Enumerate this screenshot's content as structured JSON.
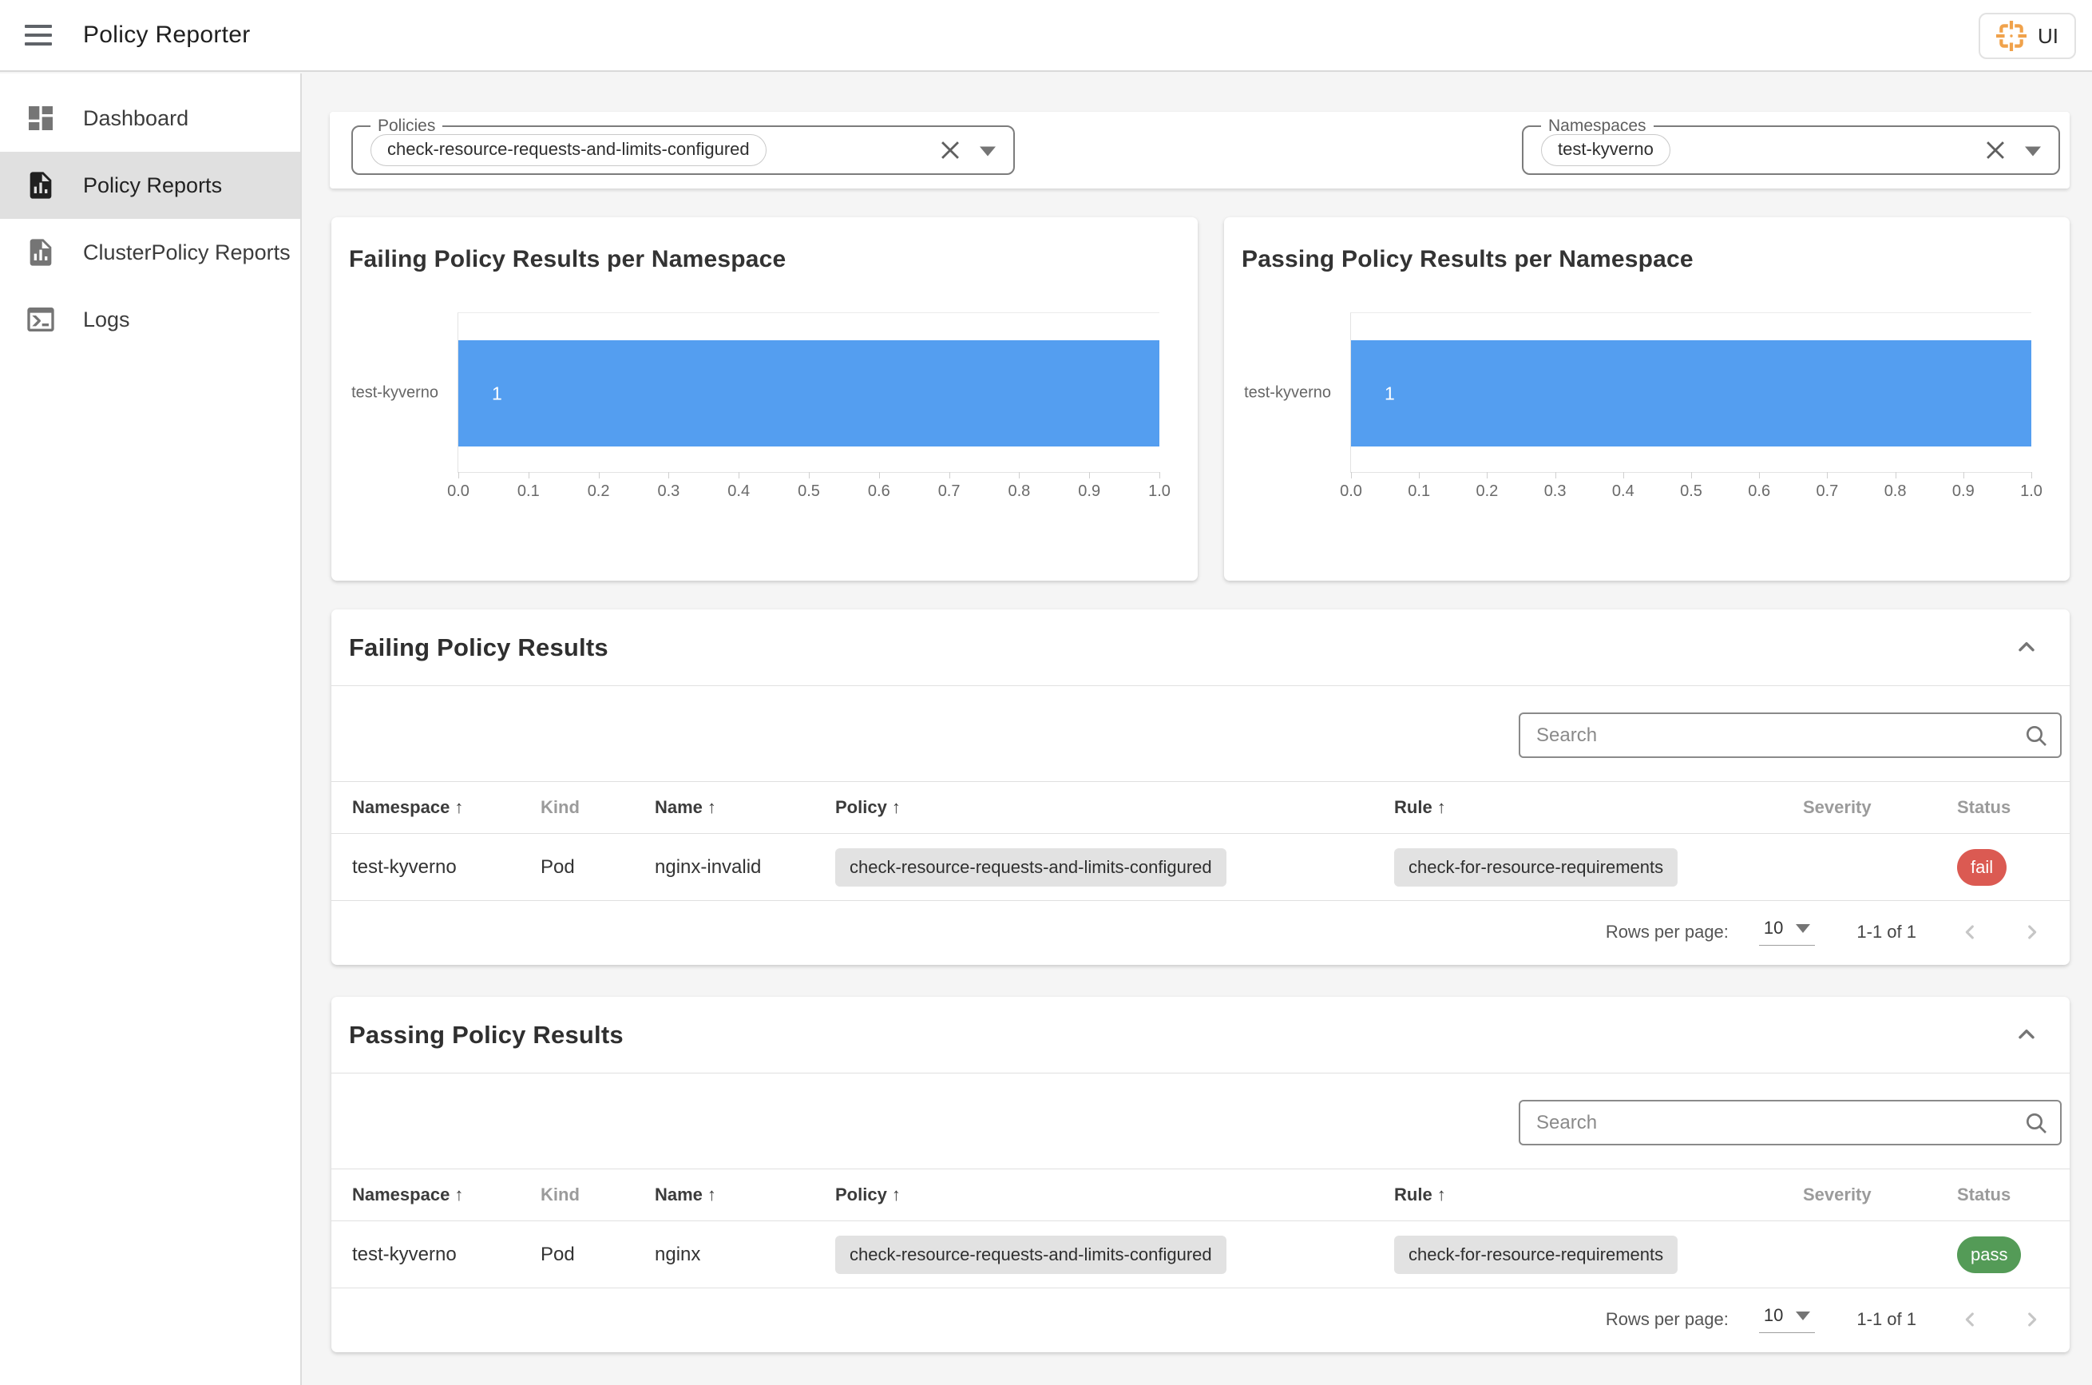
{
  "app_bar": {
    "title": "Policy Reporter",
    "ui_button_label": "UI"
  },
  "sidebar": {
    "items": [
      {
        "label": "Dashboard",
        "icon": "dashboard-icon",
        "active": false
      },
      {
        "label": "Policy Reports",
        "icon": "file-chart-icon",
        "active": true
      },
      {
        "label": "ClusterPolicy Reports",
        "icon": "file-chart-icon",
        "active": false
      },
      {
        "label": "Logs",
        "icon": "console-icon",
        "active": false
      }
    ]
  },
  "filters": {
    "policies": {
      "label": "Policies",
      "chips": [
        "check-resource-requests-and-limits-configured"
      ]
    },
    "namespaces": {
      "label": "Namespaces",
      "chips": [
        "test-kyverno"
      ]
    }
  },
  "chart_data": [
    {
      "type": "bar",
      "orientation": "horizontal",
      "title": "Failing Policy Results per Namespace",
      "categories": [
        "test-kyverno"
      ],
      "values": [
        1
      ],
      "value_labels": [
        "1"
      ],
      "xlabel": "",
      "ylabel": "",
      "xlim": [
        0,
        1
      ],
      "xtick_labels": [
        "0.0",
        "0.1",
        "0.2",
        "0.3",
        "0.4",
        "0.5",
        "0.6",
        "0.7",
        "0.8",
        "0.9",
        "1.0"
      ],
      "grid": false,
      "legend": false,
      "bar_color": "#549EF0"
    },
    {
      "type": "bar",
      "orientation": "horizontal",
      "title": "Passing Policy Results per Namespace",
      "categories": [
        "test-kyverno"
      ],
      "values": [
        1
      ],
      "value_labels": [
        "1"
      ],
      "xlabel": "",
      "ylabel": "",
      "xlim": [
        0,
        1
      ],
      "xtick_labels": [
        "0.0",
        "0.1",
        "0.2",
        "0.3",
        "0.4",
        "0.5",
        "0.6",
        "0.7",
        "0.8",
        "0.9",
        "1.0"
      ],
      "grid": false,
      "legend": false,
      "bar_color": "#549EF0"
    }
  ],
  "sections": [
    {
      "title": "Failing Policy Results",
      "search_placeholder": "Search",
      "table": {
        "columns": [
          {
            "label": "Namespace",
            "sorted": true
          },
          {
            "label": "Kind",
            "sorted": false
          },
          {
            "label": "Name",
            "sorted": true
          },
          {
            "label": "Policy",
            "sorted": true
          },
          {
            "label": "Rule",
            "sorted": true
          },
          {
            "label": "Severity",
            "sorted": false
          },
          {
            "label": "Status",
            "sorted": false
          }
        ],
        "rows": [
          {
            "namespace": "test-kyverno",
            "kind": "Pod",
            "name": "nginx-invalid",
            "policy": "check-resource-requests-and-limits-configured",
            "rule": "check-for-resource-requirements",
            "severity": "",
            "status": "fail"
          }
        ]
      },
      "pagination": {
        "rows_per_page_label": "Rows per page:",
        "rows_per_page": "10",
        "range": "1-1 of 1"
      }
    },
    {
      "title": "Passing Policy Results",
      "search_placeholder": "Search",
      "table": {
        "columns": [
          {
            "label": "Namespace",
            "sorted": true
          },
          {
            "label": "Kind",
            "sorted": false
          },
          {
            "label": "Name",
            "sorted": true
          },
          {
            "label": "Policy",
            "sorted": true
          },
          {
            "label": "Rule",
            "sorted": true
          },
          {
            "label": "Severity",
            "sorted": false
          },
          {
            "label": "Status",
            "sorted": false
          }
        ],
        "rows": [
          {
            "namespace": "test-kyverno",
            "kind": "Pod",
            "name": "nginx",
            "policy": "check-resource-requests-and-limits-configured",
            "rule": "check-for-resource-requirements",
            "severity": "",
            "status": "pass"
          }
        ]
      },
      "pagination": {
        "rows_per_page_label": "Rows per page:",
        "rows_per_page": "10",
        "range": "1-1 of 1"
      }
    }
  ],
  "icons": {
    "sort_arrow": "↑"
  },
  "colors": {
    "bar_blue": "#549EF0",
    "status_fail_red": "#DB5A52",
    "status_pass_green": "#549B57",
    "accent_orange": "#F0A24B",
    "sidebar_active_bg": "#E0E0E0"
  }
}
